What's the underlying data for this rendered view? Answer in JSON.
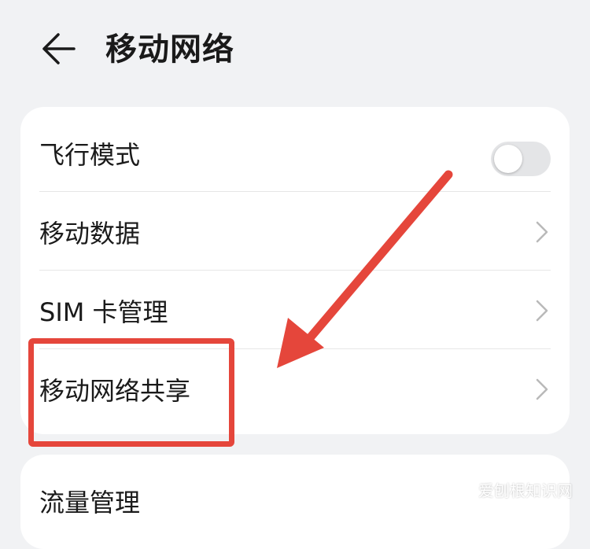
{
  "header": {
    "title": "移动网络",
    "back_icon": "arrow-left-icon"
  },
  "settings": {
    "items": [
      {
        "label": "飞行模式",
        "control": "toggle",
        "toggle_on": false
      },
      {
        "label": "移动数据",
        "control": "chevron"
      },
      {
        "label": "SIM 卡管理",
        "control": "chevron"
      },
      {
        "label": "移动网络共享",
        "control": "chevron"
      }
    ],
    "next_items": [
      {
        "label": "流量管理",
        "control": "chevron"
      }
    ]
  },
  "annotation": {
    "color": "#e5463b",
    "highlighted_item": "移动网络共享"
  },
  "watermark": "爱刨根知识网",
  "colors": {
    "background": "#f1f2f4",
    "card": "#ffffff",
    "toggle_off": "#e4e5e7",
    "chevron": "#b9b9b9"
  }
}
